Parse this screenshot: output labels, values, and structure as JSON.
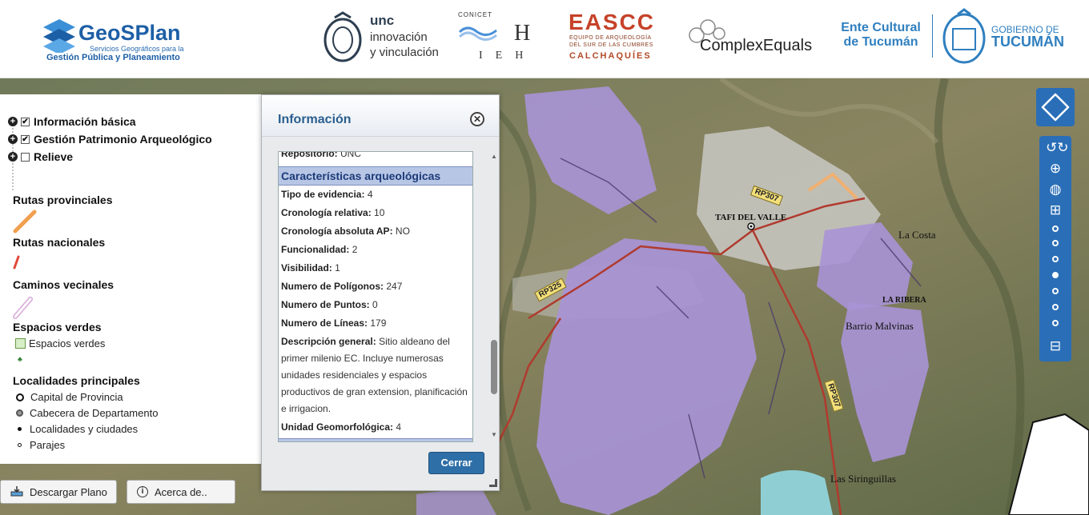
{
  "header": {
    "geosplan": {
      "name": "GeoSPlan",
      "sub1": "Servicios Geográficos para la",
      "sub2": "Gestión Pública y Planeamiento"
    },
    "unc": {
      "t1": "unc",
      "t2": "innovación",
      "t3": "y vinculación"
    },
    "ieh": {
      "conicet": "CONICET",
      "letters": "IEH"
    },
    "easc": {
      "big": "EASCC",
      "s1": "EQUIPO DE ARQUEOLOGÍA",
      "s2": "DEL SUR DE LAS CUMBRES",
      "s3": "CALCHAQUÍES"
    },
    "complex": "ComplexEquals",
    "ente": {
      "t1": "Ente Cultural",
      "t2": "de Tucumán"
    },
    "gobierno": {
      "t1": "GOBIERNO DE",
      "t2": "TUCUMÁN"
    }
  },
  "layers": {
    "tree": [
      {
        "label": "Información básica",
        "checked": true
      },
      {
        "label": "Gestión Patrimonio Arqueológico",
        "checked": true
      },
      {
        "label": "Relieve",
        "checked": false
      }
    ],
    "legend": {
      "rutas_prov": "Rutas provinciales",
      "rutas_nac": "Rutas nacionales",
      "caminos": "Caminos vecinales",
      "espacios_title": "Espacios verdes",
      "espacios_item": "Espacios verdes",
      "localidades_title": "Localidades principales",
      "capital": "Capital de Provincia",
      "cabecera": "Cabecera de Departamento",
      "localidades": "Localidades y ciudades",
      "parajes": "Parajes"
    }
  },
  "info": {
    "title": "Información",
    "repositorio_label": "Repositorio:",
    "repositorio_value": "UNC",
    "section": "Características arqueológicas",
    "fields": [
      {
        "label": "Tipo de evidencia:",
        "value": "4"
      },
      {
        "label": "Cronología relativa:",
        "value": "10"
      },
      {
        "label": "Cronología absoluta AP:",
        "value": "NO"
      },
      {
        "label": "Funcionalidad:",
        "value": "2"
      },
      {
        "label": "Visibilidad:",
        "value": "1"
      },
      {
        "label": "Numero de Polígonos:",
        "value": "247"
      },
      {
        "label": "Numero de Puntos:",
        "value": "0"
      },
      {
        "label": "Numero de Líneas:",
        "value": "179"
      }
    ],
    "descripcion_label": "Descripción general:",
    "descripcion_value": "Sitio aldeano del primer milenio EC. Incluye numerosas unidades residenciales y espacios productivos de gran extension, planificación e irrigacion.",
    "unidad_label": "Unidad Geomorfológica:",
    "unidad_value": "4",
    "close_button": "Cerrar"
  },
  "bottom": {
    "download": "Descargar Plano",
    "about": "Acerca de.."
  },
  "map_labels": {
    "tafi": "TAFI DEL VALLE",
    "la_costa": "La Costa",
    "la_ribera": "LA RIBERA",
    "barrio": "Barrio Malvinas",
    "sirunguillas": "Las Siringuillas",
    "rp307a": "RP307",
    "rp325": "RP325",
    "rp307b": "RP307"
  },
  "colors": {
    "accent": "#2a6eb7",
    "zone": "#a894d6",
    "road": "#b03a2e"
  }
}
